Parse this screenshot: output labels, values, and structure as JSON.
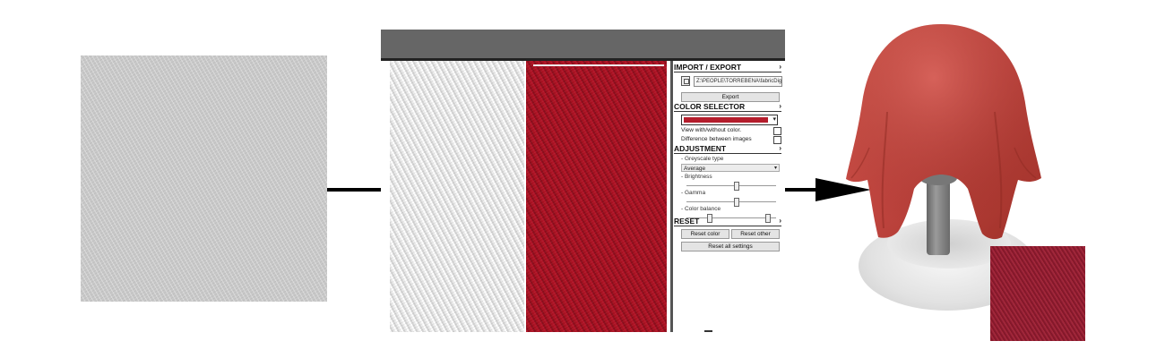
{
  "panel": {
    "import_export": {
      "title": "IMPORT / EXPORT",
      "path": "Z:\\PEOPLE\\TORREBENA\\fabricDigi",
      "export_label": "Export"
    },
    "color_selector": {
      "title": "COLOR SELECTOR",
      "selected_color": "#b41d2c",
      "view_toggle_label": "View with/without color.",
      "difference_label": "Difference between images"
    },
    "adjustment": {
      "title": "ADJUSTMENT",
      "greyscale_label": "- Greyscale type",
      "greyscale_value": "Average",
      "brightness_label": "- Brightness",
      "gamma_label": "- Gamma",
      "color_balance_label": "- Color balance",
      "brightness": 0.55,
      "gamma": 0.55,
      "color_balance": [
        0.25,
        0.9
      ]
    },
    "reset": {
      "title": "RESET",
      "reset_color": "Reset color",
      "reset_other": "Reset other",
      "reset_all": "Reset all settings"
    }
  },
  "colors": {
    "fabric_gray": "#c9c9c9",
    "fabric_white": "#e8e8e8",
    "fabric_red": "#a31020",
    "cloth_render": "#c0453f",
    "inset_swatch": "#92203a"
  }
}
